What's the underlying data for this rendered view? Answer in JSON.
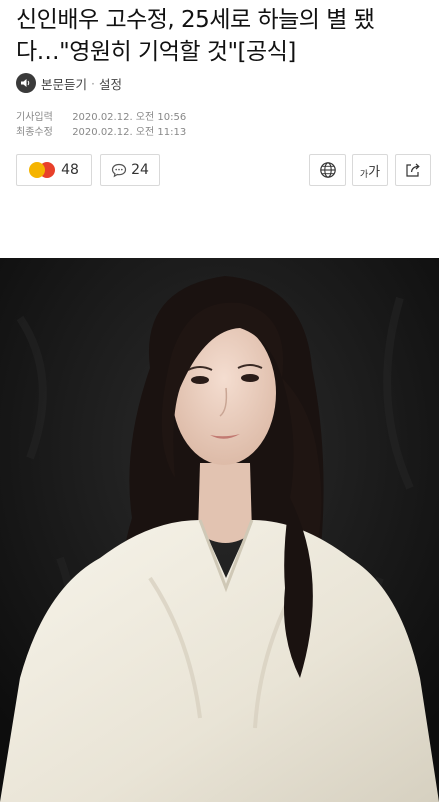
{
  "article": {
    "title_line1": "신인배우 고수정, 25세로 하늘의 별 됐",
    "title_line2": "다…\"영원히 기억할 것\"[공식]"
  },
  "audio": {
    "listen_label": "본문듣기",
    "settings_label": "설정",
    "separator": "·"
  },
  "dates": {
    "published_label": "기사입력",
    "published_value": "2020.02.12. 오전 10:56",
    "modified_label": "최종수정",
    "modified_value": "2020.02.12. 오전 11:13"
  },
  "actions": {
    "reaction_count": "48",
    "comment_count": "24",
    "font_label": "가",
    "font_small_label": "가",
    "icons": [
      "reaction-emoji-icon",
      "comment-bubble-icon",
      "globe-icon",
      "font-size-icon",
      "share-icon"
    ]
  },
  "colors": {
    "emoji_yellow": "#f5b400",
    "emoji_red": "#e8402a",
    "listen_icon": "#3a3a3a"
  }
}
